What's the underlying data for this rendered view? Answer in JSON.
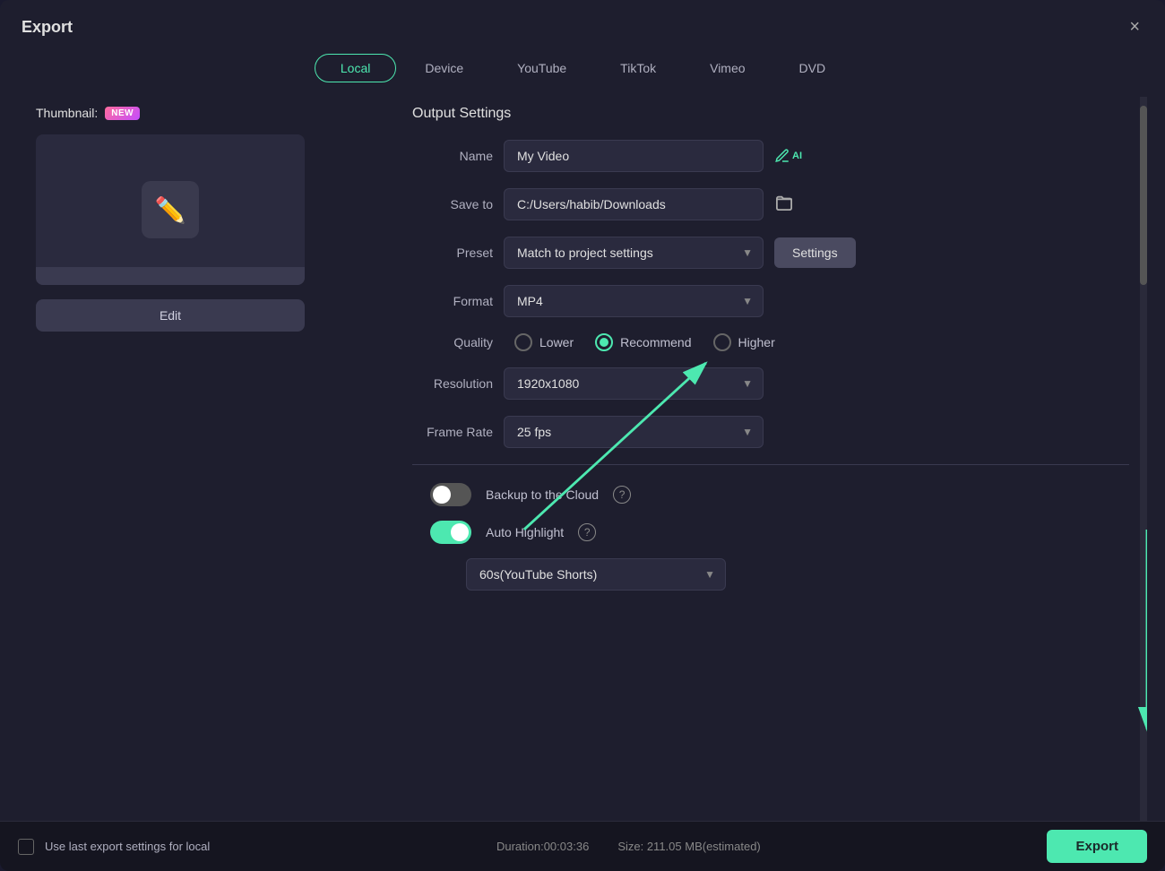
{
  "dialog": {
    "title": "Export",
    "close_label": "×"
  },
  "tabs": [
    {
      "label": "Local",
      "active": true
    },
    {
      "label": "Device",
      "active": false
    },
    {
      "label": "YouTube",
      "active": false
    },
    {
      "label": "TikTok",
      "active": false
    },
    {
      "label": "Vimeo",
      "active": false
    },
    {
      "label": "DVD",
      "active": false
    }
  ],
  "left_panel": {
    "thumbnail_label": "Thumbnail:",
    "new_badge": "NEW",
    "edit_button": "Edit"
  },
  "right_panel": {
    "output_settings_title": "Output Settings",
    "name_label": "Name",
    "name_value": "My Video",
    "save_to_label": "Save to",
    "save_to_value": "C:/Users/habib/Downloads",
    "preset_label": "Preset",
    "preset_value": "Match to project settings",
    "settings_button": "Settings",
    "format_label": "Format",
    "format_value": "MP4",
    "quality_label": "Quality",
    "quality_options": [
      {
        "label": "Lower",
        "selected": false
      },
      {
        "label": "Recommend",
        "selected": true
      },
      {
        "label": "Higher",
        "selected": false
      }
    ],
    "resolution_label": "Resolution",
    "resolution_value": "1920x1080",
    "frame_rate_label": "Frame Rate",
    "frame_rate_value": "25 fps",
    "backup_label": "Backup to the Cloud",
    "backup_on": false,
    "auto_highlight_label": "Auto Highlight",
    "auto_highlight_on": true,
    "highlight_select_value": "60s(YouTube Shorts)"
  },
  "bottom_bar": {
    "checkbox_label": "Use last export settings for local",
    "duration_text": "Duration:00:03:36",
    "size_text": "Size: 211.05 MB(estimated)",
    "export_button": "Export"
  }
}
